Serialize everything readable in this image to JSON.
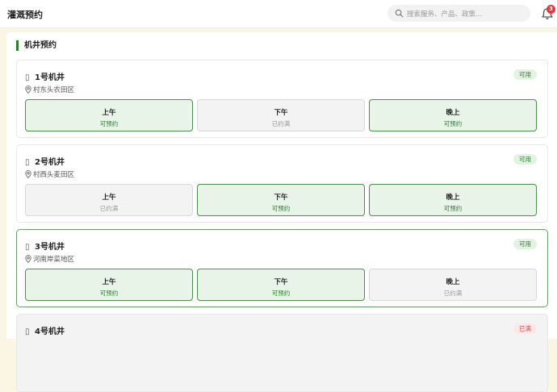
{
  "header": {
    "title": "灌溉预约",
    "search_placeholder": "搜索服务、产品、政策...",
    "notification_count": "3"
  },
  "section": {
    "title": "机井预约"
  },
  "wells": [
    {
      "name": "1号机井",
      "location": "村东头农田区",
      "status": "可用",
      "status_type": "ok",
      "slots": [
        {
          "name": "上午",
          "state": "可预约",
          "available": true
        },
        {
          "name": "下午",
          "state": "已约满",
          "available": false
        },
        {
          "name": "晚上",
          "state": "可预约",
          "available": true
        }
      ]
    },
    {
      "name": "2号机井",
      "location": "村西头麦田区",
      "status": "可用",
      "status_type": "ok",
      "slots": [
        {
          "name": "上午",
          "state": "已约满",
          "available": false
        },
        {
          "name": "下午",
          "state": "可预约",
          "available": true
        },
        {
          "name": "晚上",
          "state": "可预约",
          "available": true
        }
      ]
    },
    {
      "name": "3号机井",
      "location": "河南岸菜地区",
      "status": "可用",
      "status_type": "ok",
      "slots": [
        {
          "name": "上午",
          "state": "可预约",
          "available": true
        },
        {
          "name": "下午",
          "state": "可预约",
          "available": true
        },
        {
          "name": "晚上",
          "state": "已约满",
          "available": false
        }
      ]
    },
    {
      "name": "4号机井",
      "status": "已满",
      "status_type": "full"
    }
  ]
}
